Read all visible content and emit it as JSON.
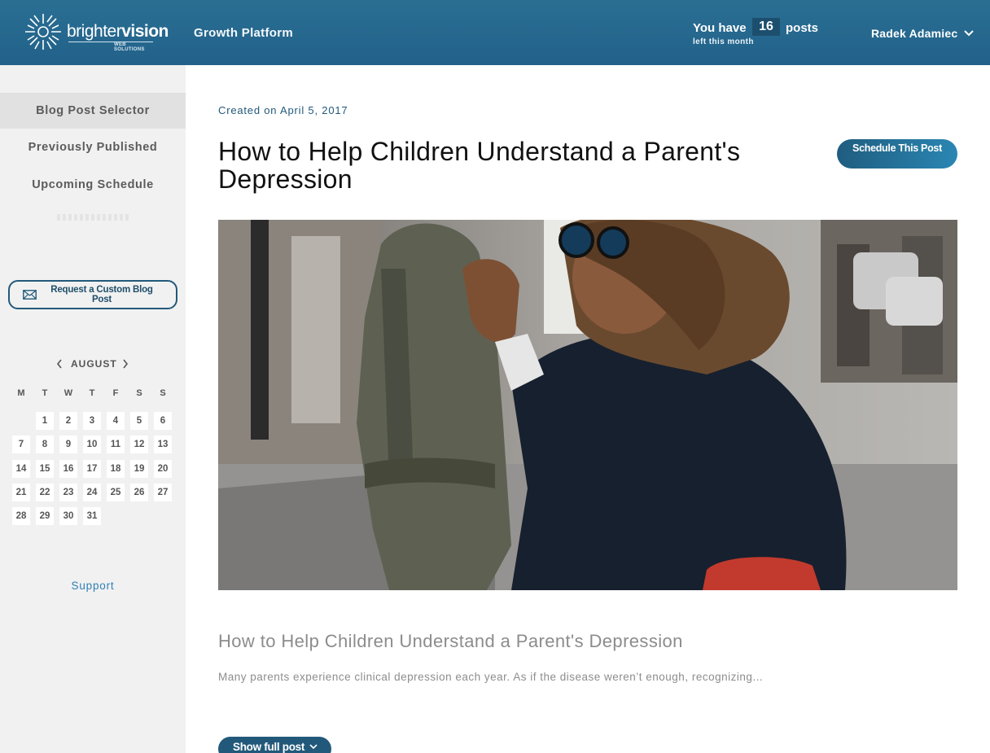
{
  "header": {
    "logo_text_light": "brighter",
    "logo_text_bold": "vision",
    "logo_subtext": "WEB SOLUTIONS",
    "platform_name": "Growth Platform",
    "posts_prefix": "You have",
    "posts_count": "16",
    "posts_suffix": "posts",
    "posts_subtext": "left this month",
    "user_name": "Radek Adamiec"
  },
  "sidebar": {
    "nav": [
      {
        "label": "Blog Post Selector",
        "active": true
      },
      {
        "label": "Previously Published",
        "active": false
      },
      {
        "label": "Upcoming Schedule",
        "active": false
      }
    ],
    "request_button": "Request a Custom Blog Post",
    "calendar": {
      "month": "AUGUST",
      "weekdays": [
        "M",
        "T",
        "W",
        "T",
        "F",
        "S",
        "S"
      ],
      "days": [
        "1",
        "2",
        "3",
        "4",
        "5",
        "6",
        "7",
        "8",
        "9",
        "10",
        "11",
        "12",
        "13",
        "14",
        "15",
        "16",
        "17",
        "18",
        "19",
        "20",
        "21",
        "22",
        "23",
        "24",
        "25",
        "26",
        "27",
        "28",
        "29",
        "30",
        "31"
      ]
    },
    "support": "Support"
  },
  "main": {
    "created": "Created on April 5, 2017",
    "title": "How to Help Children Understand a Parent's Depression",
    "schedule_button": "Schedule This Post",
    "subtitle": "How to Help Children Understand a Parent's Depression",
    "excerpt": "Many parents experience clinical depression each year. As if the disease weren’t enough, recognizing...",
    "show_button": "Show full post"
  },
  "colors": {
    "header": "#2a6f93",
    "accent": "#22597a",
    "sidebar_bg": "#f1f1f1",
    "link": "#2d7fb6"
  }
}
